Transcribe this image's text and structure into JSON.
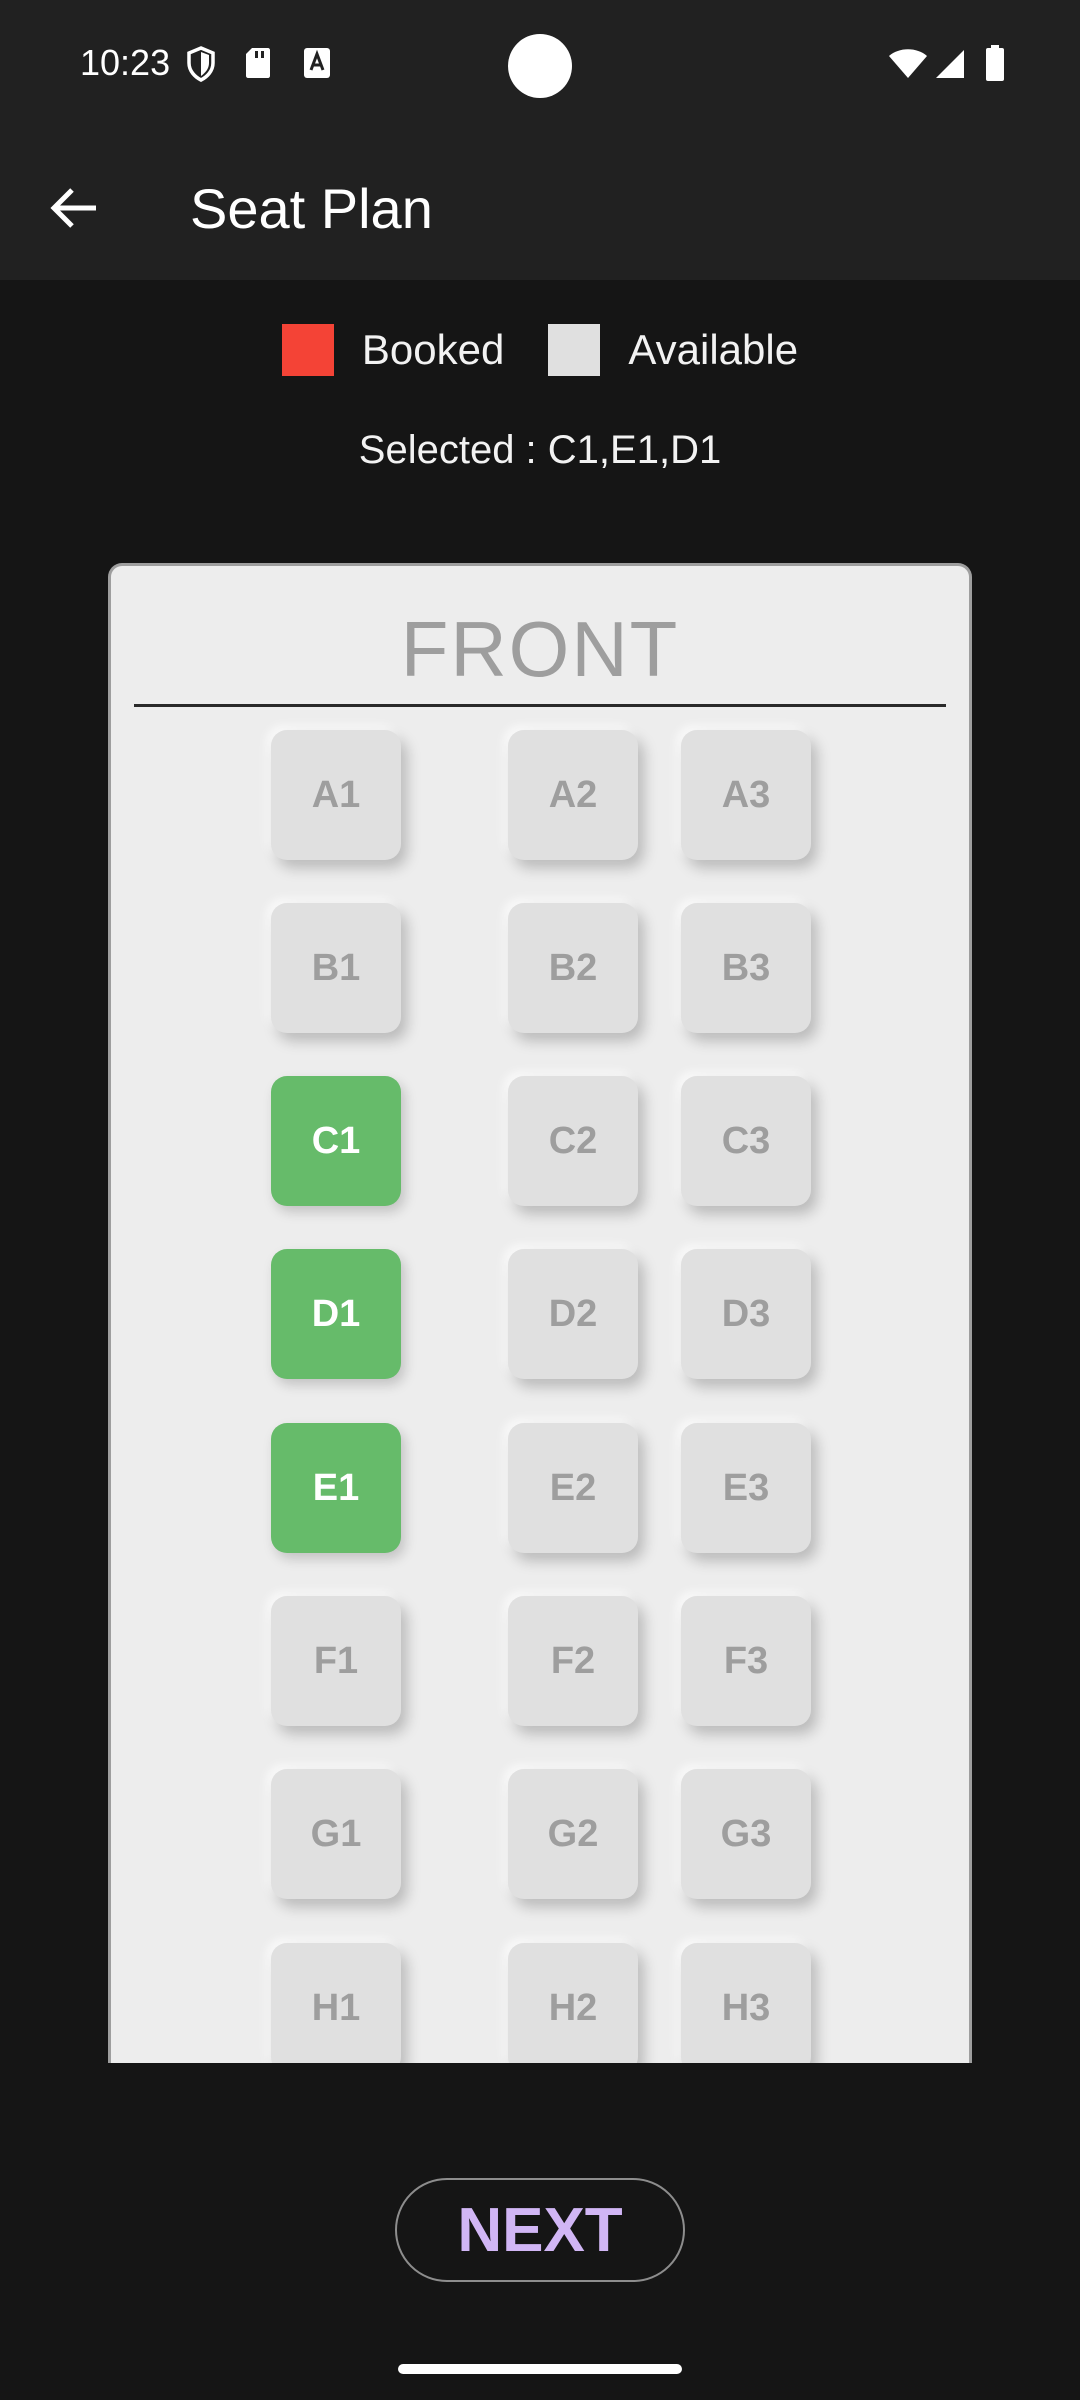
{
  "status_bar": {
    "time": "10:23"
  },
  "app_bar": {
    "title": "Seat Plan"
  },
  "legend": {
    "booked_label": "Booked",
    "booked_color": "#f44336",
    "available_label": "Available",
    "available_color": "#e0e0e0"
  },
  "selected_text": "Selected : C1,E1,D1",
  "plan": {
    "front_label": "FRONT",
    "seats": {
      "A1": "A1",
      "A2": "A2",
      "A3": "A3",
      "B1": "B1",
      "B2": "B2",
      "B3": "B3",
      "C1": "C1",
      "C2": "C2",
      "C3": "C3",
      "D1": "D1",
      "D2": "D2",
      "D3": "D3",
      "E1": "E1",
      "E2": "E2",
      "E3": "E3",
      "F1": "F1",
      "F2": "F2",
      "F3": "F3",
      "G1": "G1",
      "G2": "G2",
      "G3": "G3",
      "H1": "H1",
      "H2": "H2",
      "H3": "H3"
    },
    "selected_seats": [
      "C1",
      "D1",
      "E1"
    ],
    "selected_color": "#66bb6a"
  },
  "next_button": {
    "label": "NEXT",
    "color": "#d1b6f5"
  }
}
